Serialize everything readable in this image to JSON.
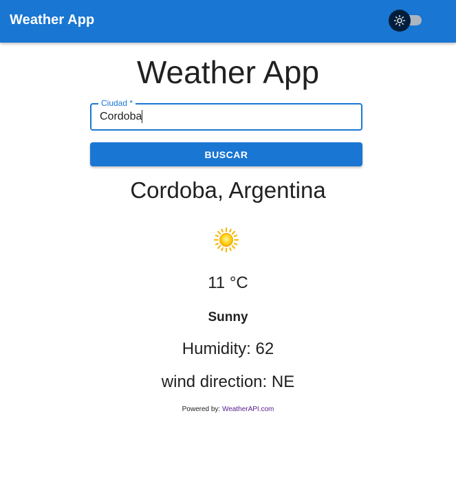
{
  "appbar": {
    "title": "Weather App",
    "theme_toggle": {
      "icon": "sun-icon",
      "state": "off"
    },
    "color": "#1976d2"
  },
  "main": {
    "title": "Weather App",
    "search": {
      "label": "Ciudad *",
      "value": "Cordoba"
    },
    "button_label": "BUSCAR"
  },
  "result": {
    "location": "Cordoba, Argentina",
    "icon": "sun-icon",
    "temperature": "11 °C",
    "condition": "Sunny",
    "humidity": "Humidity: 62",
    "wind": "wind direction: NE"
  },
  "footer": {
    "powered_label": "Powered by:",
    "powered_link": "WeatherAPI.com"
  }
}
